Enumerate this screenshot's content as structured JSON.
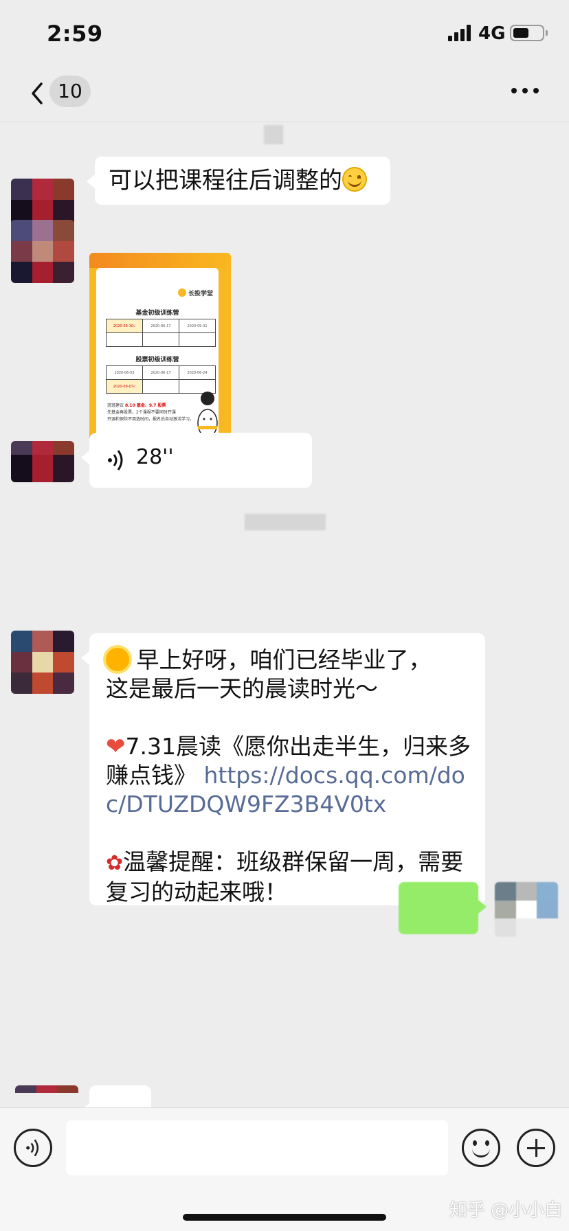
{
  "status_bar": {
    "time": "2:59",
    "network": "4G"
  },
  "nav": {
    "unread_count": "10"
  },
  "messages": {
    "m1_text": "可以把课程往后调整的",
    "poster": {
      "brand": "长投学堂",
      "section1_title": "基金初级训练营",
      "section1_dates": [
        "2020-06-10√",
        "2020-06-17",
        "2020-09-31"
      ],
      "section2_title": "股票初级训练营",
      "section2_dates": [
        "2020-06-03",
        "2020-06-17",
        "2020-06-24"
      ],
      "section2_row2": [
        "2020-09-07√",
        "",
        ""
      ],
      "note_line1_prefix": "班班建议",
      "note_line1_highlight": "8.10 基金、9.7 股票",
      "note_line2": "先基金再股票，2个课程不要同时开课",
      "note_line3": "开源和保险不用选时间，报名后自动激活学习。"
    },
    "voice_duration": "28''",
    "long_line1": "早上好呀，咱们已经毕业了，",
    "long_line2": "这是最后一天的晨读时光～",
    "long_line3": "7.31晨读《愿你出走半生，归来多赚点钱》",
    "long_link": "https://docs.qq.com/doc/DTUZDQW9FZ3B4V0tx",
    "long_line4": "温馨提醒：班级群保留一周，需要复习的动起来哦！"
  },
  "input_bar": {
    "placeholder": ""
  },
  "watermark": "知乎 @小小白"
}
